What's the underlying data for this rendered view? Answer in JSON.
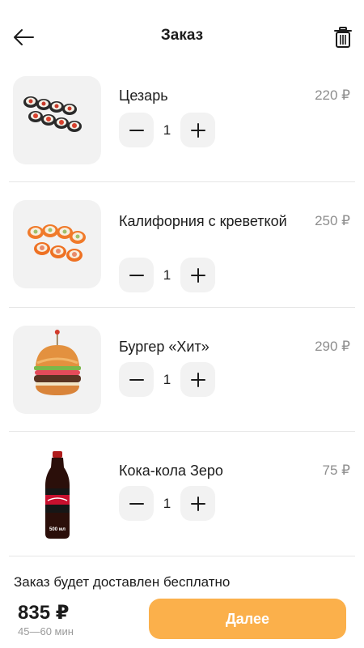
{
  "header": {
    "title": "Заказ",
    "back_icon": "arrow-left-icon",
    "trash_icon": "trash-icon"
  },
  "items": [
    {
      "name": "Цезарь",
      "price": "220 ₽",
      "qty": "1",
      "image": "sushi-rolls-caesar"
    },
    {
      "name": "Калифорния с креветкой",
      "price": "250 ₽",
      "qty": "1",
      "image": "sushi-rolls-california"
    },
    {
      "name": "Бургер «Хит»",
      "price": "290 ₽",
      "qty": "1",
      "image": "burger"
    },
    {
      "name": "Кока-кола Зеро",
      "price": "75 ₽",
      "qty": "1",
      "image": "cola-bottle",
      "bottle_label": "500 мл"
    }
  ],
  "delivery_note": "Заказ будет доставлен бесплатно",
  "footer": {
    "total": "835 ₽",
    "eta": "45—60 мин",
    "next_label": "Далее"
  },
  "colors": {
    "accent": "#fbb04b",
    "text": "#1c1c1c",
    "muted": "#8e8e8e",
    "button_bg": "#f2f2f2"
  }
}
